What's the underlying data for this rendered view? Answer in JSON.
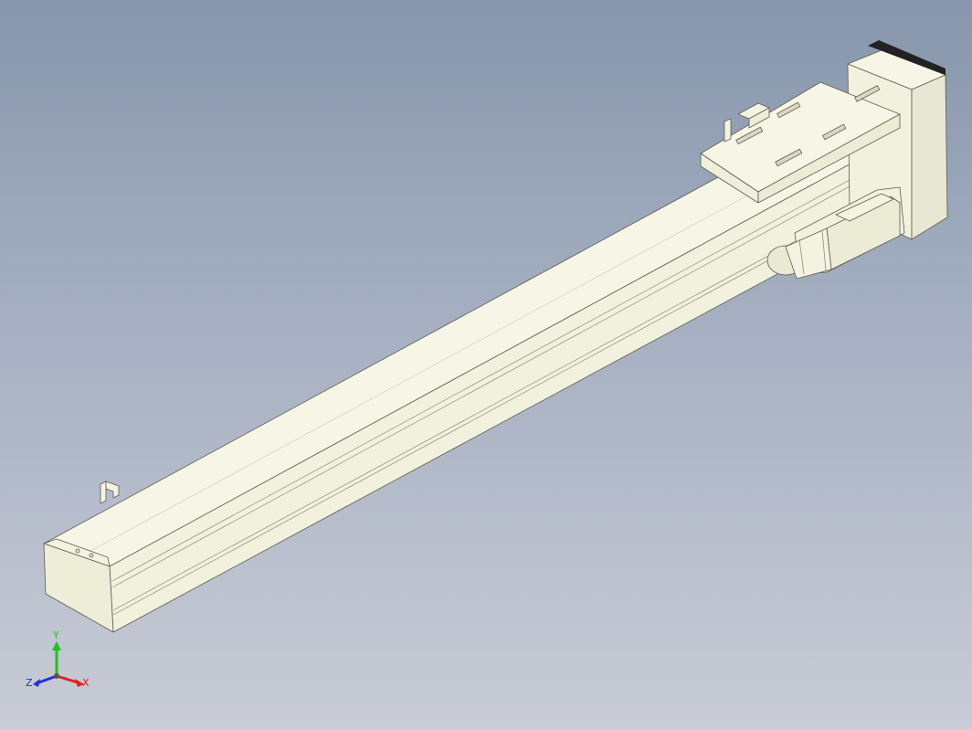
{
  "viewport": {
    "background_top": "#8796ac",
    "background_bottom": "#c9ccd6"
  },
  "model": {
    "part_color": "#f6f5e4",
    "edge_color": "#5c5c52",
    "shadow_color": "#dcdcc8",
    "motor_dark": "#3a3a3a"
  },
  "triad": {
    "x_label": "X",
    "y_label": "Y",
    "z_label": "Z",
    "x_color": "#e02020",
    "y_color": "#20c020",
    "z_color": "#2030e0"
  }
}
